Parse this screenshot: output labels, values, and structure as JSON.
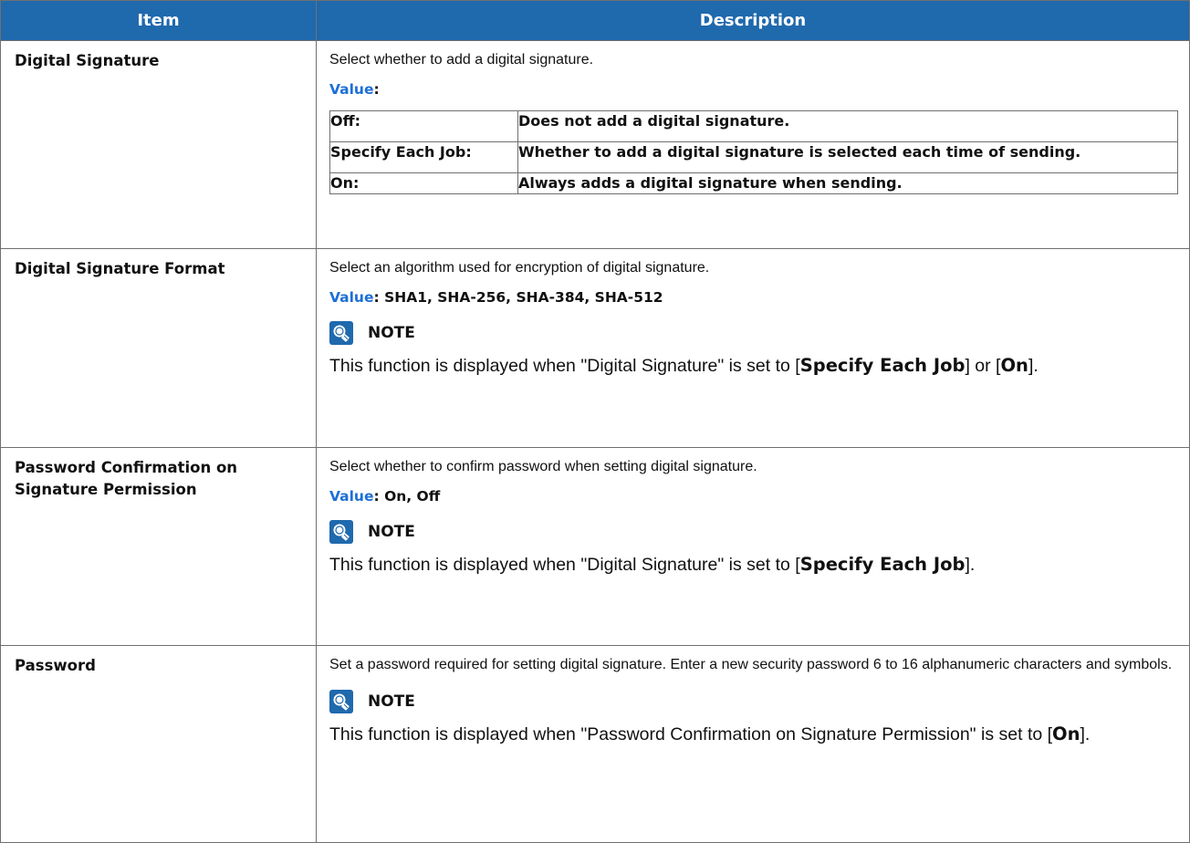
{
  "header": {
    "item": "Item",
    "description": "Description"
  },
  "value_label": "Value",
  "rows": [
    {
      "item": "Digital Signature",
      "text": "Select whether to add a digital signature.",
      "value_suffix": ":",
      "options": [
        {
          "label": "Off:",
          "desc": "Does not add a digital signature."
        },
        {
          "label": "Specify Each Job:",
          "desc": "Whether to add a digital signature is selected each time of sending."
        },
        {
          "label": "On:",
          "desc": "Always adds a digital signature when sending."
        }
      ]
    },
    {
      "item": "Digital Signature Format",
      "text": "Select an algorithm used for encryption of digital signature.",
      "value_suffix": ": SHA1, SHA-256, SHA-384, SHA-512",
      "note_title": "NOTE",
      "note_pre": "This function is displayed when \"Digital Signature\" is set to [",
      "note_b1": "Specify Each Job",
      "note_mid": "] or [",
      "note_b2": "On",
      "note_post": "]."
    },
    {
      "item": "Password Confirmation on Signature Permission",
      "text": "Select whether to confirm password when setting digital signature.",
      "value_suffix": ": On, Off",
      "note_title": "NOTE",
      "note_pre": "This function is displayed when \"Digital Signature\" is set to [",
      "note_b1": "Specify Each Job",
      "note_post": "]."
    },
    {
      "item": "Password",
      "text": "Set a password required for setting digital signature. Enter a new security password 6 to 16 alphanumeric characters and symbols.",
      "note_title": "NOTE",
      "note_pre": "This function is displayed when \"Password Confirmation on Signature Permission\" is set to [",
      "note_b1": "On",
      "note_post": "]."
    }
  ]
}
